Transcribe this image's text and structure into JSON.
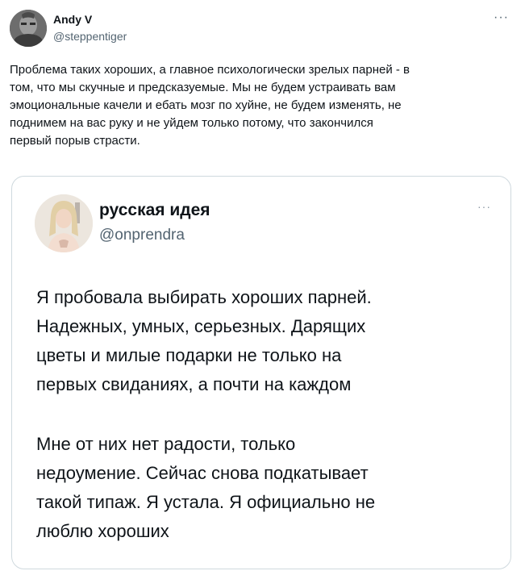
{
  "tweet": {
    "author": {
      "name": "Andy V",
      "handle": "@steppentiger"
    },
    "more_label": "···",
    "text": "Проблема таких хороших, а главное психологически зрелых парней - в\nтом, что мы скучные и предсказуемые. Мы не будем устраивать вам\nэмоциональные качели и ебать мозг по хуйне, не будем изменять, не\nподнимем на вас руку и не уйдем только потому, что закончился\nпервый порыв страсти.",
    "quoted": {
      "author": {
        "name": "русская идея",
        "handle": "@onprendra"
      },
      "more_label": "···",
      "paragraphs": [
        "Я пробовала выбирать хороших парней.\nНадежных, умных, серьезных. Дарящих\nцветы и милые подарки не только на\nпервых свиданиях, а почти на каждом",
        "Мне от них нет радости, только\nнедоумение. Сейчас снова подкатывает\nтакой типаж. Я устала. Я официально не\nлюблю хороших"
      ]
    }
  }
}
